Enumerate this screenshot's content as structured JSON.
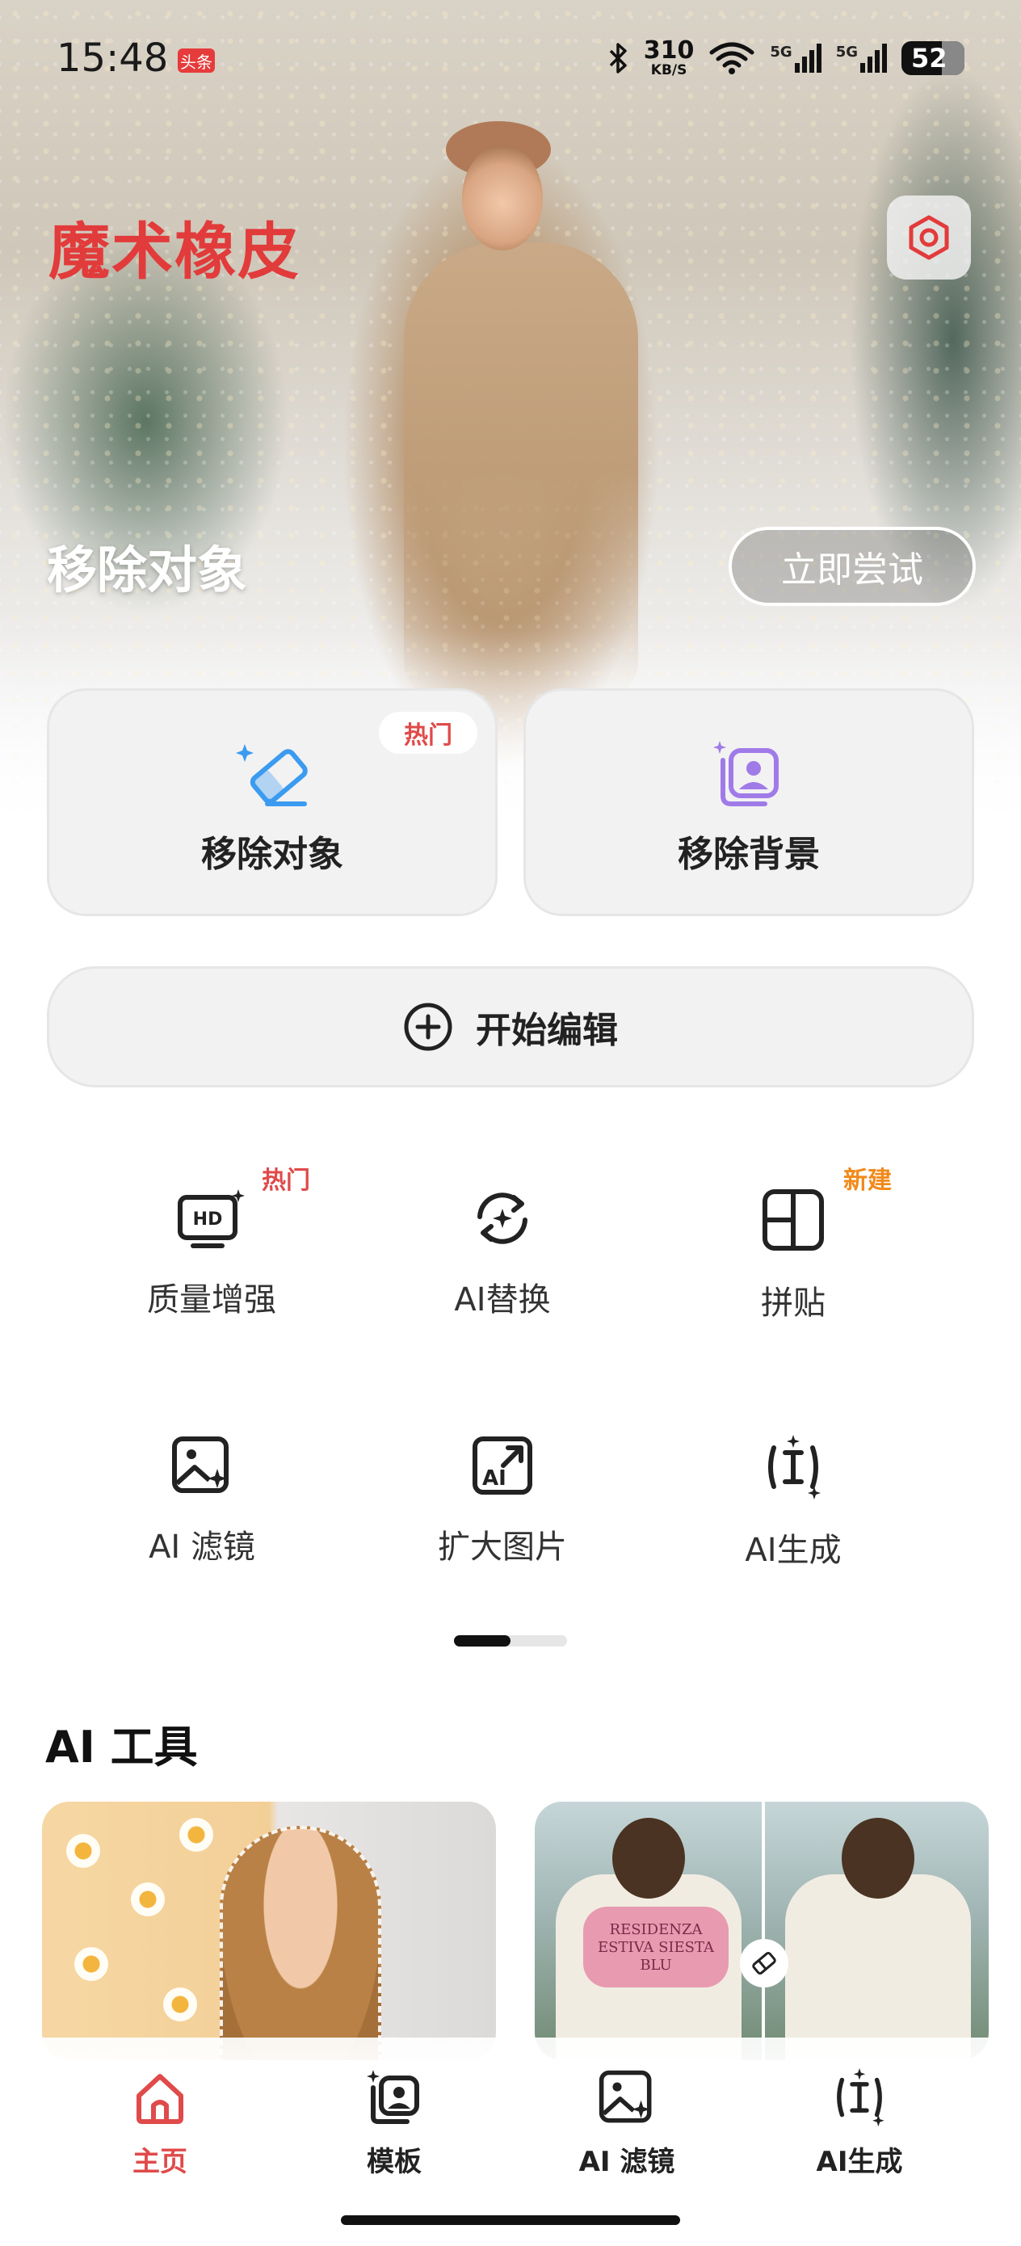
{
  "status_bar": {
    "time": "15:48",
    "app_badge": "头条",
    "net_speed_value": "310",
    "net_speed_unit": "KB/S",
    "signal_1": "5G",
    "signal_2": "5G",
    "battery": "52"
  },
  "hero": {
    "brand": "魔术橡皮",
    "caption": "移除对象",
    "try_button": "立即尝试"
  },
  "feature_cards": [
    {
      "label": "移除对象",
      "tag": "热门",
      "icon": "eraser-sparkle-icon"
    },
    {
      "label": "移除背景",
      "icon": "image-stack-person-icon"
    }
  ],
  "edit_bar": {
    "label": "开始编辑",
    "icon": "plus-circle-icon"
  },
  "tools": [
    {
      "label": "质量增强",
      "tag": "热门",
      "icon": "hd-monitor-icon"
    },
    {
      "label": "AI替换",
      "icon": "swap-sparkle-icon"
    },
    {
      "label": "拼贴",
      "tag": "新建",
      "icon": "collage-grid-icon"
    },
    {
      "label": "AI 滤镜",
      "icon": "image-sparkle-icon"
    },
    {
      "label": "扩大图片",
      "icon": "ai-expand-icon"
    },
    {
      "label": "AI生成",
      "icon": "text-cursor-sparkle-icon"
    }
  ],
  "pager": {
    "pages": 2,
    "active": 1
  },
  "section": {
    "title": "AI 工具",
    "thumb2_print": "RESIDENZA ESTIVA SIESTA BLU"
  },
  "bottom_nav": [
    {
      "label": "主页",
      "icon": "home-icon",
      "active": true
    },
    {
      "label": "模板",
      "icon": "template-icon"
    },
    {
      "label": "AI 滤镜",
      "icon": "image-sparkle-icon"
    },
    {
      "label": "AI生成",
      "icon": "text-cursor-sparkle-icon"
    }
  ],
  "colors": {
    "brand_red": "#e23b3b",
    "hot_tag": "#e04a4a",
    "new_tag": "#f08a1c",
    "icon_blue": "#3b9bf0",
    "icon_purple": "#a07be8"
  }
}
